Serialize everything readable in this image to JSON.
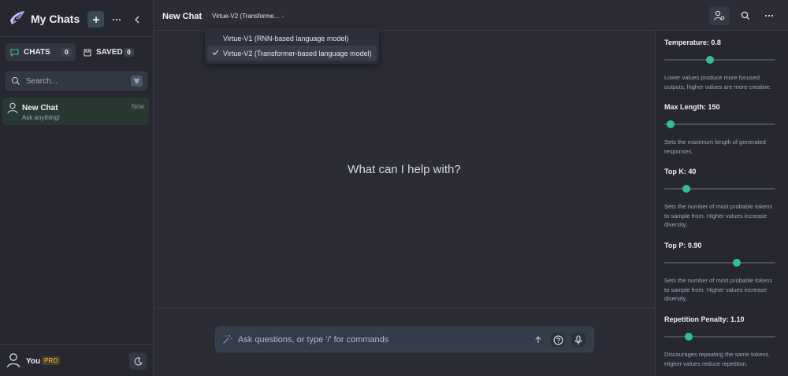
{
  "sidebar": {
    "title": "My Chats",
    "tabs": [
      {
        "label": "CHATS",
        "count": "0"
      },
      {
        "label": "SAVED",
        "count": "0"
      }
    ],
    "search": {
      "placeholder": "Search...",
      "value": ""
    },
    "chats": [
      {
        "title": "New Chat",
        "subtitle": "Ask anything!",
        "time": "Now"
      }
    ],
    "user": {
      "name": "You",
      "plan": "PRO"
    }
  },
  "header": {
    "title": "New Chat",
    "model_selected_display": "Virtue-V2 (Transforme..."
  },
  "model_dropdown": {
    "options": [
      {
        "label": "Virtue-V1 (RNN-based language model)",
        "selected": false
      },
      {
        "label": "Virtue-V2 (Transformer-based language model)",
        "selected": true
      }
    ]
  },
  "main": {
    "hero": "What can I help with?"
  },
  "composer": {
    "placeholder": "Ask questions, or type '/' for commands",
    "value": ""
  },
  "settings": {
    "params": [
      {
        "label": "Temperature: 0.8",
        "fraction": 0.41,
        "desc": "Lower values produce more focused outputs, higher values are more creative."
      },
      {
        "label": "Max Length: 150",
        "fraction": 0.06,
        "desc": "Sets the maximum length of generated responses."
      },
      {
        "label": "Top K: 40",
        "fraction": 0.2,
        "desc": "Sets the number of most probable tokens to sample from. Higher values increase diversity."
      },
      {
        "label": "Top P: 0.90",
        "fraction": 0.65,
        "desc": "Sets the number of most probable tokens to sample from. Higher values increase diversity."
      },
      {
        "label": "Repetition Penalty: 1.10",
        "fraction": 0.22,
        "desc": "Discourages repeating the same tokens. Higher values reduce repetition."
      }
    ]
  },
  "colors": {
    "accent": "#2ec293",
    "background": "#2b2c36",
    "sidebar": "#262731",
    "pro_badge": "#f0c36b"
  },
  "icons": [
    "logo-eye-icon",
    "plus-icon",
    "more-icon",
    "chevron-left-icon",
    "chat-bubble-icon",
    "bookmark-icon",
    "search-icon",
    "filter-icon",
    "avatar-icon",
    "user-icon",
    "moon-icon",
    "persona-settings-icon",
    "check-icon",
    "magic-wand-icon",
    "arrow-up-icon",
    "help-icon",
    "microphone-icon"
  ]
}
